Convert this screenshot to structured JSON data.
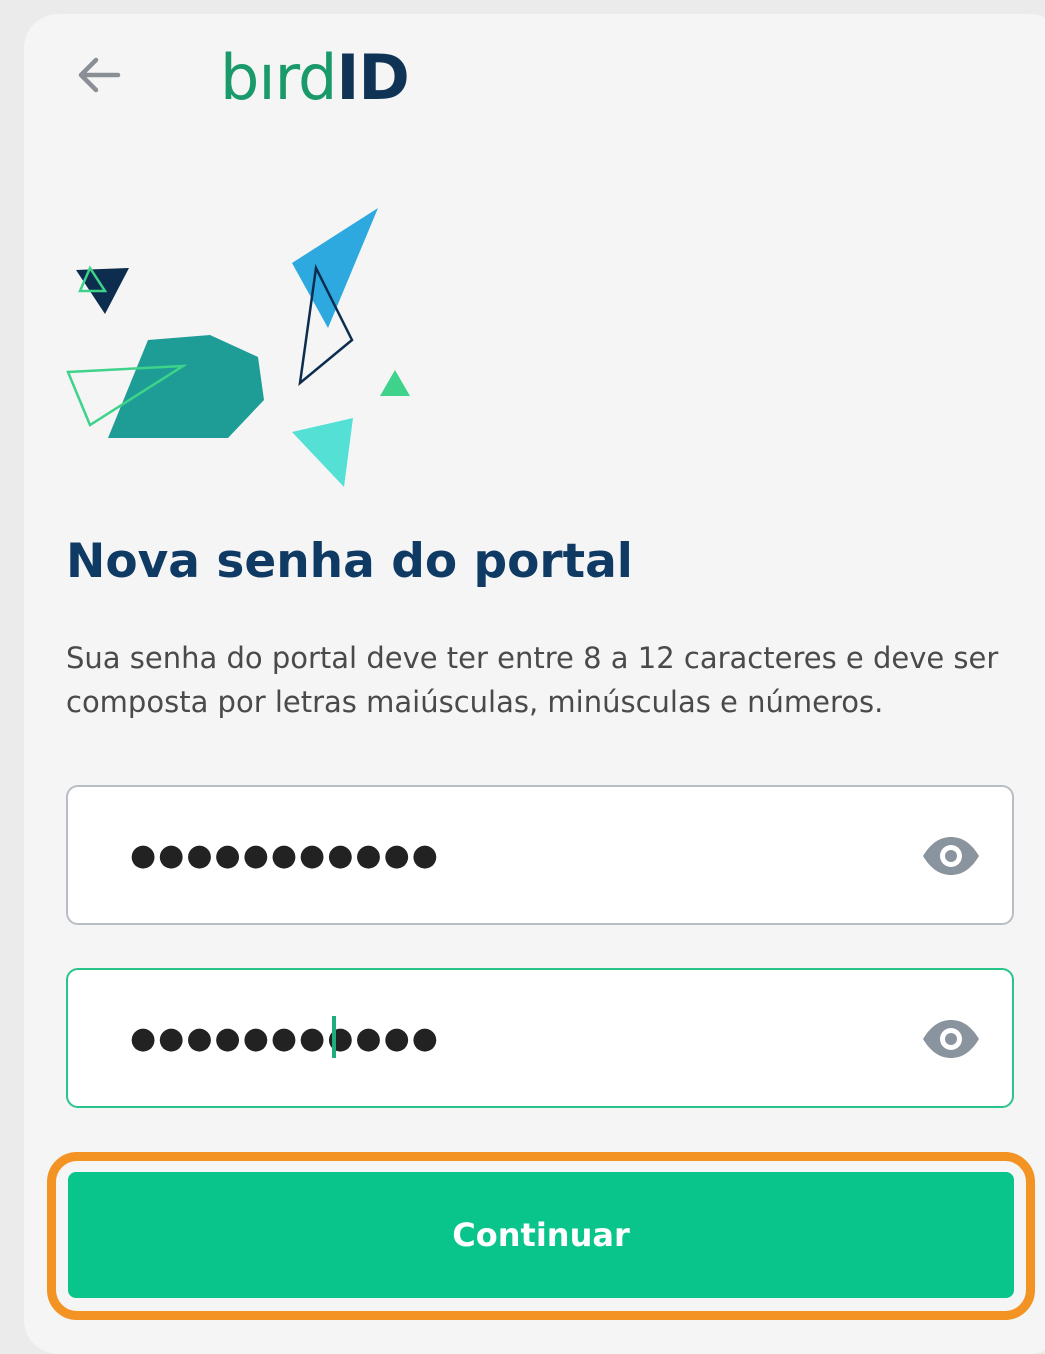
{
  "header": {
    "back_icon": "arrow-left-icon",
    "logo_bird": "bırd",
    "logo_id": "ID"
  },
  "main": {
    "title": "Nova senha do portal",
    "description": "Sua senha do portal deve ter entre 8 a 12 caracteres e deve ser composta por letras maiúsculas, minúsculas e números.",
    "password_field": {
      "value": "●●●●●●●●●●●",
      "icon": "eye-icon"
    },
    "confirm_field": {
      "value": "●●●●●●●●●●●",
      "icon": "eye-icon",
      "focused": true
    },
    "continue_label": "Continuar"
  },
  "colors": {
    "brand_green": "#09c48b",
    "title_navy": "#0e3a63",
    "highlight_orange": "#f39323"
  }
}
